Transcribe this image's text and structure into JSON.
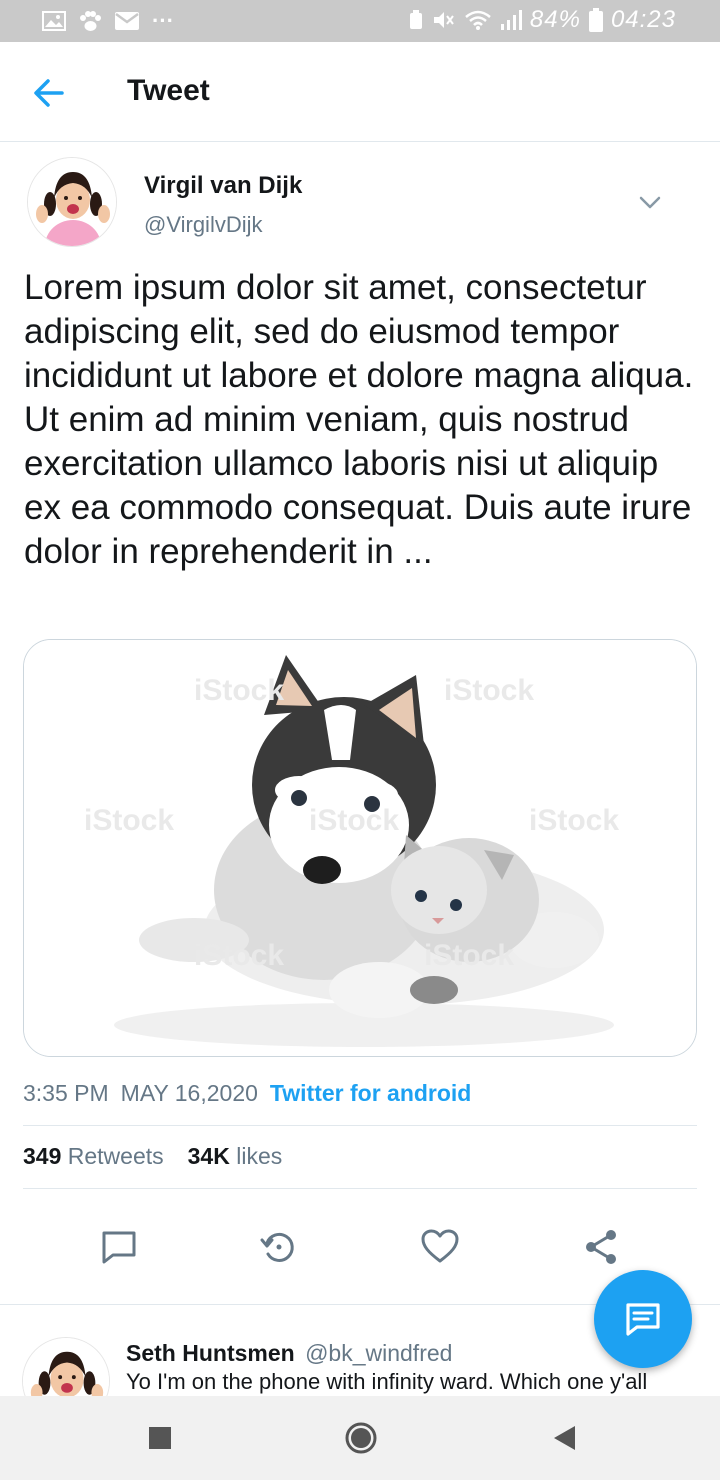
{
  "status_bar": {
    "battery": "84%",
    "time": "04:23",
    "overflow": "···"
  },
  "header": {
    "title": "Tweet",
    "back_icon": "arrow-left-icon"
  },
  "tweet": {
    "author_name": "Virgil van Dijk",
    "author_handle": "@VirgilvDijk",
    "text": "Lorem ipsum dolor sit amet, consectetur adipiscing elit, sed do eiusmod tempor incididunt ut labore et dolore magna aliqua. Ut enim ad minim veniam, quis nostrud exercitation ullamco laboris nisi ut aliquip ex ea commodo consequat. Duis aute irure dolor in reprehenderit in ...",
    "time": "3:35 PM",
    "date": "MAY 16,2020",
    "source": "Twitter for android",
    "retweets_count": "349",
    "retweets_label": "Retweets",
    "likes_count": "34K",
    "likes_label": "likes"
  },
  "reply": {
    "author_name": "Seth Huntsmen",
    "author_handle": "@bk_windfred",
    "text": "Yo I'm on the phone with infinity ward. Which one y'all"
  },
  "colors": {
    "accent": "#1da1f2",
    "text": "#14171a",
    "muted": "#657786",
    "status_bar": "#c9c9c9"
  }
}
